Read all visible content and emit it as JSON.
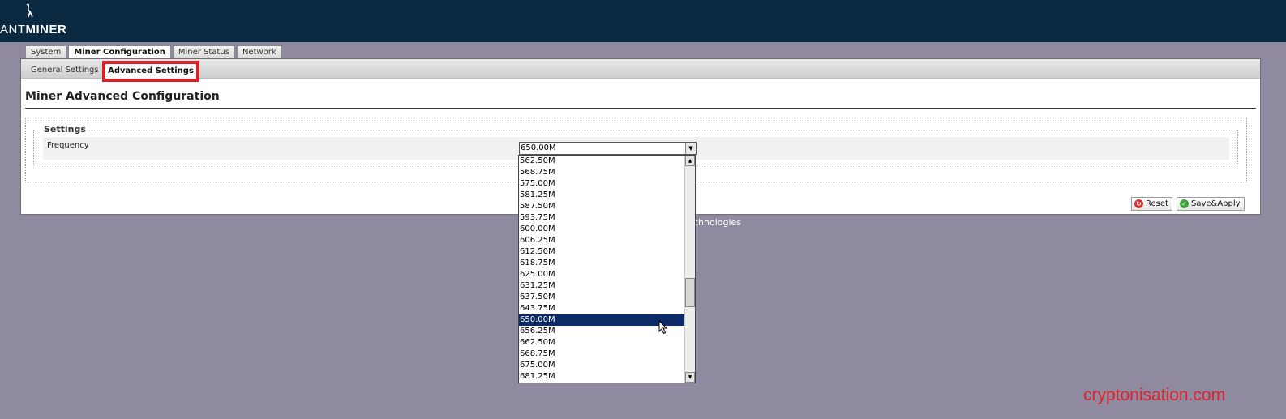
{
  "app": {
    "logo_left": "ANT",
    "logo_right": "MINER"
  },
  "tabs": [
    {
      "label": "System"
    },
    {
      "label": "Miner Configuration"
    },
    {
      "label": "Miner Status"
    },
    {
      "label": "Network"
    }
  ],
  "subtabs": {
    "general": "General Settings",
    "advanced": "Advanced Settings"
  },
  "page": {
    "title": "Miner Advanced Configuration",
    "section_legend": "Settings",
    "frequency_label": "Frequency",
    "frequency_value": "650.00M"
  },
  "frequency_options": [
    "562.50M",
    "568.75M",
    "575.00M",
    "581.25M",
    "587.50M",
    "593.75M",
    "600.00M",
    "606.25M",
    "612.50M",
    "618.75M",
    "625.00M",
    "631.25M",
    "637.50M",
    "643.75M",
    "650.00M",
    "656.25M",
    "662.50M",
    "668.75M",
    "675.00M",
    "681.25M"
  ],
  "selected_index": 14,
  "buttons": {
    "reset": "Reset",
    "save_apply": "Save&Apply"
  },
  "footer": {
    "copyright_fragment": "chnologies"
  },
  "watermark": "cryptonisation.com",
  "colors": {
    "header_bg": "#0b2a42",
    "page_bg": "#8f8aa0",
    "highlight_box": "#d92027",
    "selected_option": "#0b2a66",
    "watermark": "#e0232c"
  }
}
